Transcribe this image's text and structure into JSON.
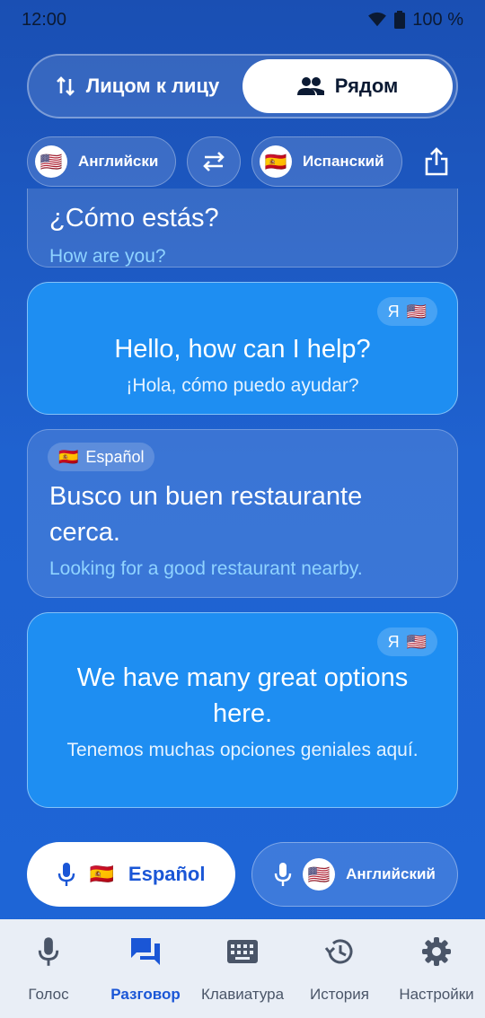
{
  "status": {
    "time": "12:00",
    "battery": "100 %"
  },
  "mode_toggle": {
    "face_to_face": "Лицом к лицу",
    "nearby": "Рядом"
  },
  "languages": {
    "left": {
      "flag": "🇺🇸",
      "label": "Английски"
    },
    "right": {
      "flag": "🇪🇸",
      "label": "Испанский"
    }
  },
  "messages": [
    {
      "main": "¿Cómo estás?",
      "sub": "How are you?"
    },
    {
      "badge_me": "Я",
      "badge_flag": "🇺🇸",
      "main": "Hello, how can I help?",
      "sub": "¡Hola, cómo puedo ayudar?"
    },
    {
      "badge_flag": "🇪🇸",
      "badge_label": "Español",
      "main": "Busco un buen restaurante cerca.",
      "sub": "Looking for a good restaurant nearby."
    },
    {
      "badge_me": "Я",
      "badge_flag": "🇺🇸",
      "main": "We have many great options here.",
      "sub": "Tenemos muchas opciones geniales aquí."
    }
  ],
  "mic": {
    "left_flag": "🇪🇸",
    "left_label": "Español",
    "right_flag": "🇺🇸",
    "right_label": "Английский"
  },
  "nav": [
    {
      "label": "Голос",
      "icon": "mic-icon"
    },
    {
      "label": "Разговор",
      "icon": "chat-icon",
      "active": true
    },
    {
      "label": "Клавиатура",
      "icon": "keyboard-icon"
    },
    {
      "label": "История",
      "icon": "history-icon"
    },
    {
      "label": "Настройки",
      "icon": "settings-icon"
    }
  ],
  "colors": {
    "accent": "#1a56d6",
    "card_me": "#1e8ef2"
  }
}
